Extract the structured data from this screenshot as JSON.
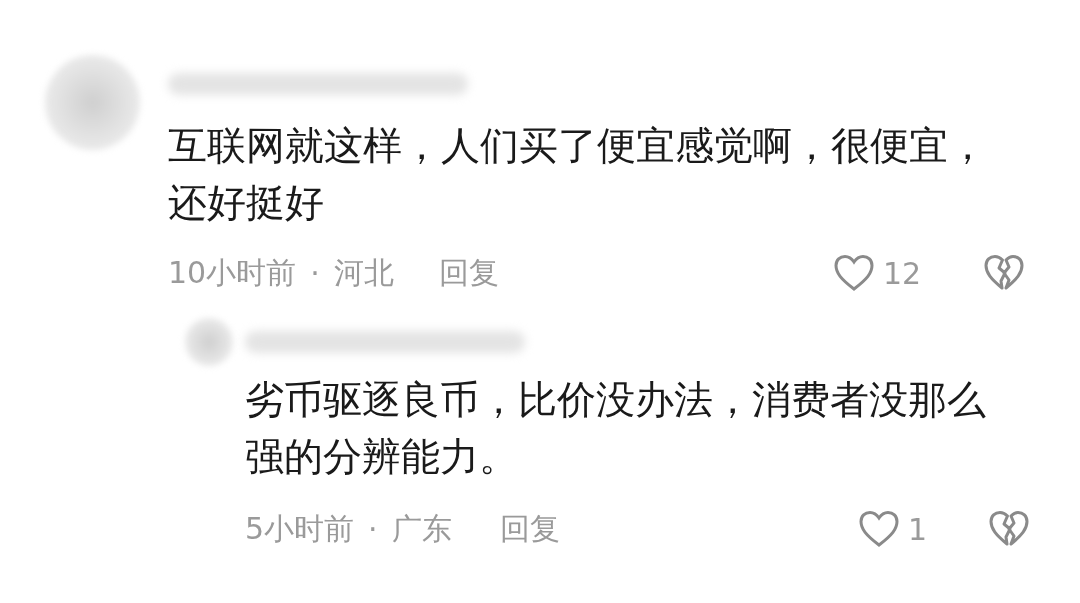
{
  "comments": [
    {
      "text": "互联网就这样，人们买了便宜感觉啊，很便宜，还好挺好",
      "time": "10小时前",
      "separator": "·",
      "region": "河北",
      "reply_label": "回复",
      "likes": "12",
      "replies": [
        {
          "text": "劣币驱逐良币，比价没办法，消费者没那么强的分辨能力。",
          "time": "5小时前",
          "separator": "·",
          "region": "广东",
          "reply_label": "回复",
          "likes": "1"
        }
      ]
    }
  ]
}
